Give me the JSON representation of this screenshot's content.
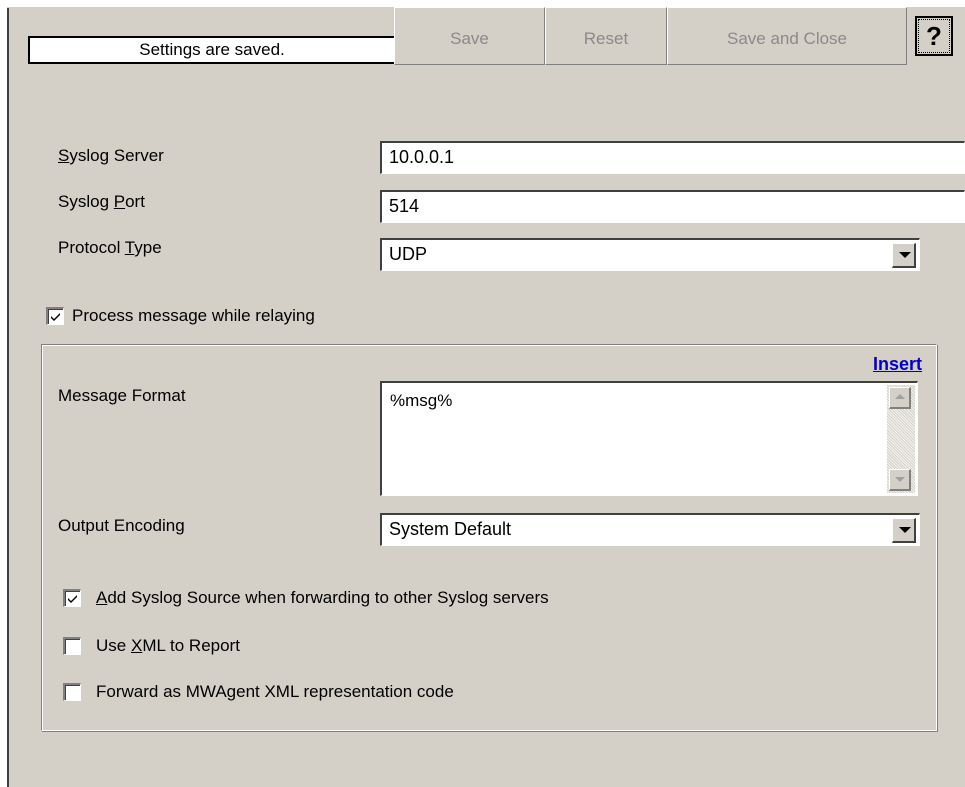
{
  "toolbar": {
    "status_text": "Settings are saved.",
    "save_label": "Save",
    "reset_label": "Reset",
    "save_close_label": "Save and Close",
    "help_label": "?"
  },
  "fields": {
    "syslog_server": {
      "label_accel": "S",
      "label_rest": "yslog Server",
      "value": "10.0.0.1"
    },
    "syslog_port": {
      "label_pre": "Syslog ",
      "label_accel": "P",
      "label_rest": "ort",
      "value": "514"
    },
    "protocol_type": {
      "label_pre": "Protocol ",
      "label_accel": "T",
      "label_rest": "ype",
      "value": "UDP"
    }
  },
  "process_message": {
    "label": "Process message while relaying",
    "checked": true
  },
  "group": {
    "insert_label": "Insert",
    "message_format": {
      "label": "Message Format",
      "value": "%msg%"
    },
    "output_encoding": {
      "label": "Output Encoding",
      "value": "System Default"
    },
    "add_source": {
      "label_accel": "A",
      "label_rest": "dd Syslog Source when forwarding to other Syslog servers",
      "checked": true
    },
    "use_xml": {
      "label_pre": "Use ",
      "label_accel": "X",
      "label_rest": "ML to Report",
      "checked": false
    },
    "forward_mwagent": {
      "label": "Forward as MWAgent XML representation code",
      "checked": false
    }
  }
}
